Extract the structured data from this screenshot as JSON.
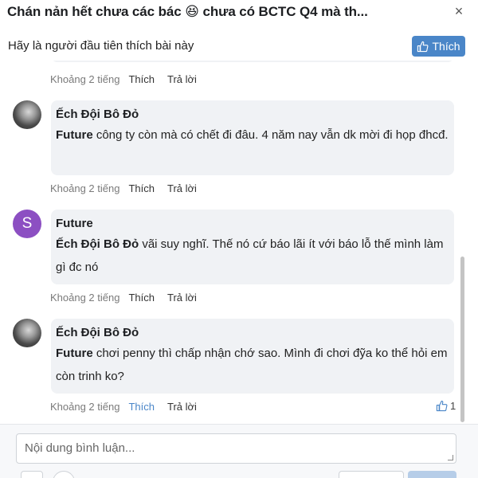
{
  "header": {
    "title": "Chán nản hết chưa các bác 😆 chưa có BCTC Q4 mà th...",
    "close_glyph": "×"
  },
  "likebar": {
    "text": "Hãy là người đầu tiên thích bài này",
    "like_button": "Thích"
  },
  "comments": [
    {
      "author": "",
      "text": "",
      "time": "Khoảng 2 tiếng",
      "like": "Thích",
      "reply": "Trả lời"
    },
    {
      "author": "Ếch Đội Bô Đỏ",
      "mention": "Future",
      "text": " công ty còn mà có chết đi đâu. 4 năm nay vẫn dk mời đi họp đhcđ.",
      "time": "Khoảng 2 tiếng",
      "like": "Thích",
      "reply": "Trả lời",
      "avatar": "photo-avatar"
    },
    {
      "author": "Future",
      "mention": "Ếch Đội Bô Đỏ",
      "text": " vãi suy nghĩ. Thế nó cứ báo lãi ít với báo lỗ thế mình làm gì đc nó",
      "time": "Khoảng 2 tiếng",
      "like": "Thích",
      "reply": "Trả lời",
      "avatar_letter": "S",
      "avatar_color": "#8c4fc2"
    },
    {
      "author": "Ếch Đội Bô Đỏ",
      "mention": "Future",
      "text": " chơi penny thì chấp nhận chớ sao. Mình đi chơi đỹa ko thể hỏi em còn trinh ko?",
      "time": "Khoảng 2 tiếng",
      "like": "Thích",
      "reply": "Trả lời",
      "like_count": "1",
      "avatar": "photo-avatar"
    }
  ],
  "composer": {
    "placeholder": "Nội dung bình luận..."
  },
  "colors": {
    "accent": "#4a86c8",
    "bubble": "#f0f2f5",
    "avatar_purple": "#8c4fc2"
  }
}
